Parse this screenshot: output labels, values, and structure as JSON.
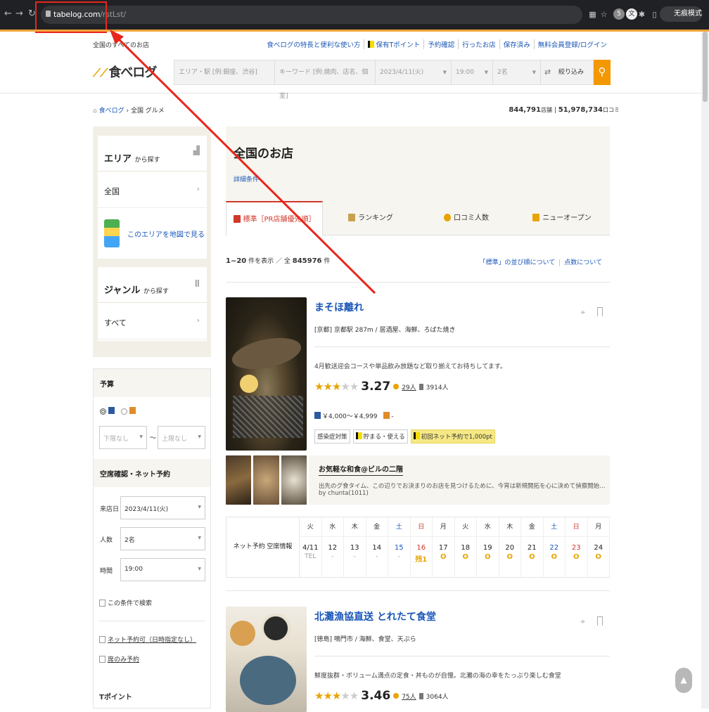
{
  "browser": {
    "url_domain": "tabelog.com",
    "url_path": "/rstLst/",
    "profile_label": "无痕模式",
    "ext_badge": "5",
    "avatar_letter": "文"
  },
  "header": {
    "all_stores": "全国のすべてのお店",
    "links": [
      "食べログの特長と便利な使い方",
      "保有Tポイント",
      "予約確認",
      "行ったお店",
      "保存済み",
      "無料会員登録/ログイン"
    ],
    "logo": "食べログ",
    "search": {
      "area_placeholder": "エリア・駅 [例:銀座、渋谷]",
      "keyword_placeholder": "キーワード [例:焼肉、店名、個室]",
      "date": "2023/4/11(火)",
      "time": "19:00",
      "people": "2名",
      "refine": "絞り込み"
    }
  },
  "breadcrumb": {
    "home": "食べログ",
    "current": "全国 グルメ"
  },
  "counts": {
    "stores": "844,791",
    "stores_unit": "店舗",
    "reviews": "51,978,734",
    "reviews_unit": "口コミ"
  },
  "sidebar": {
    "area_title": "エリア",
    "area_suffix": "から探す",
    "area_all": "全国",
    "map_link": "このエリアを地図で見る",
    "genre_title": "ジャンル",
    "genre_suffix": "から探す",
    "genre_all": "すべて",
    "budget_title": "予算",
    "budget_min": "下限なし",
    "budget_max": "上限なし",
    "budget_sep": "～",
    "vacancy_title": "空席確認・ネット予約",
    "visit_label": "来店日",
    "visit_value": "2023/4/11(火)",
    "people_label": "人数",
    "people_value": "2名",
    "time_label": "時間",
    "time_value": "19:00",
    "search_cond": "この条件で検索",
    "net_reserve": "ネット予約可（日時指定なし）",
    "seat_only": "席のみ予約",
    "tpoint": "Tポイント"
  },
  "main": {
    "title": "全国のお店",
    "detail": "詳細条件",
    "tabs": [
      "標準［PR店舗優先順］",
      "ランキング",
      "口コミ人数",
      "ニューオープン"
    ],
    "result_prefix": "1~20",
    "result_mid": "件を表示 ／ 全",
    "result_total": "845976",
    "result_suffix": "件",
    "sort_link1": "「標準」の並び順について",
    "sort_link2": "点数について"
  },
  "restaurants": [
    {
      "name": "まそほ離れ",
      "area": "[京都] 京都駅 287m / 居酒屋、海鮮、ろばた焼き",
      "desc": "4月歓送迎会コースや単品飲み放題など取り揃えてお待ちしてます。",
      "score": "3.27",
      "reviews": "29人",
      "saves": "3914人",
      "price_night": "￥4,000～￥4,999",
      "price_lunch": "-",
      "tags": [
        "感染症対策",
        "貯まる・使える",
        "初回ネット予約で1,000pt"
      ],
      "review_title": "お気軽な和食@ビルの二階",
      "review_body": "出先のグ食タイム、この辺りでお決まりのお店を見つけるために、今宵は新規開拓を心に決めて偵察開始… by chunta(1011)",
      "calendar_label": "ネット予約 空席情報",
      "calendar": {
        "days": [
          "火",
          "水",
          "木",
          "金",
          "土",
          "日",
          "月",
          "火",
          "水",
          "木",
          "金",
          "土",
          "日",
          "月"
        ],
        "dates": [
          "4/11",
          "12",
          "13",
          "14",
          "15",
          "16",
          "17",
          "18",
          "19",
          "20",
          "21",
          "22",
          "23",
          "24"
        ],
        "status": [
          "TEL",
          "-",
          "-",
          "-",
          "-",
          "残1",
          "O",
          "O",
          "O",
          "O",
          "O",
          "O",
          "O",
          "O"
        ]
      }
    },
    {
      "name": "北灘漁協直送 とれたて食堂",
      "area": "[徳島] 鳴門市 / 海鮮、食堂、天ぷら",
      "desc": "鮮度抜群・ボリューム満点の定食・丼ものが自慢。北灘の海の幸をたっぷり楽しむ食堂",
      "score": "3.46",
      "reviews": "75人",
      "saves": "3064人"
    }
  ],
  "colors": {
    "accent": "#f39800",
    "link": "#1a56b8",
    "annotation": "#e8261d"
  }
}
